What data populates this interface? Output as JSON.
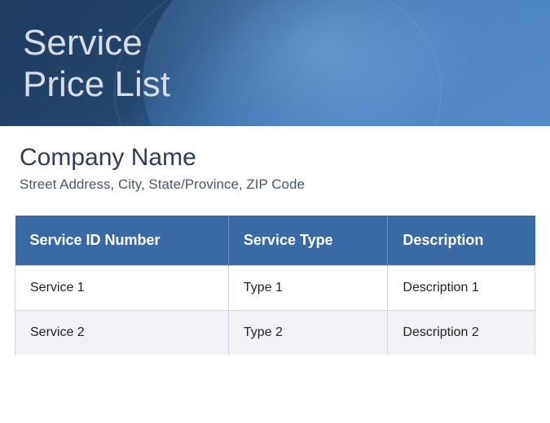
{
  "header": {
    "title_line1": "Service",
    "title_line2": "Price List"
  },
  "company": {
    "name": "Company Name",
    "address": "Street Address, City, State/Province, ZIP Code"
  },
  "table": {
    "columns": [
      "Service ID Number",
      "Service Type",
      "Description"
    ],
    "rows": [
      {
        "id": "Service 1",
        "type": "Type 1",
        "desc": "Description 1"
      },
      {
        "id": "Service 2",
        "type": "Type 2",
        "desc": "Description 2"
      }
    ]
  }
}
